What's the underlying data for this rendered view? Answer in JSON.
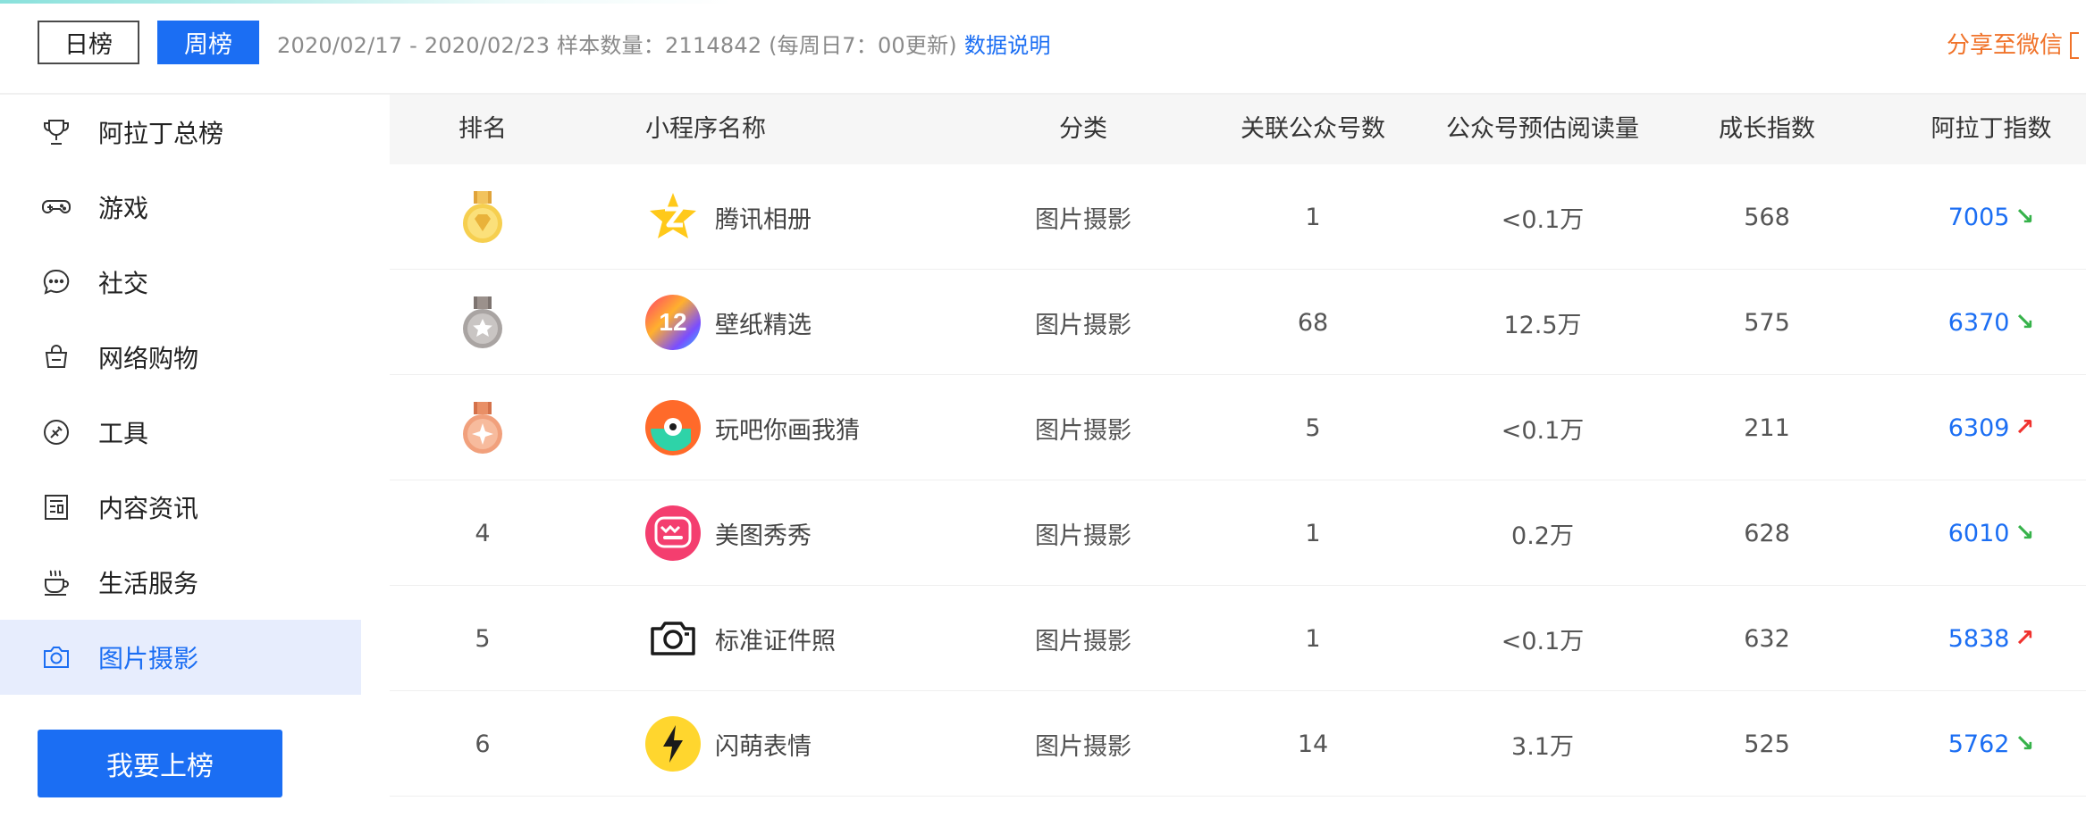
{
  "header": {
    "tab_daily": "日榜",
    "tab_weekly": "周榜",
    "date_range": "2020/02/17 - 2020/02/23  样本数量：2114842 (每周日7：00更新)",
    "data_explain": "数据说明",
    "share": "分享至微信"
  },
  "colors": {
    "accent": "#1b6ef3",
    "share": "#f0732a",
    "trend_down": "#36b24a",
    "trend_up": "#f0322e",
    "sidebar_active_bg": "#e7edfd"
  },
  "sidebar": {
    "items": [
      {
        "label": "阿拉丁总榜",
        "icon": "trophy-icon",
        "active": false
      },
      {
        "label": "游戏",
        "icon": "gamepad-icon",
        "active": false
      },
      {
        "label": "社交",
        "icon": "chat-bubble-icon",
        "active": false
      },
      {
        "label": "网络购物",
        "icon": "shopping-bag-icon",
        "active": false
      },
      {
        "label": "工具",
        "icon": "tool-icon",
        "active": false
      },
      {
        "label": "内容资讯",
        "icon": "news-icon",
        "active": false
      },
      {
        "label": "生活服务",
        "icon": "coffee-cup-icon",
        "active": false
      },
      {
        "label": "图片摄影",
        "icon": "camera-icon",
        "active": true
      }
    ],
    "cta_label": "我要上榜"
  },
  "table": {
    "columns": [
      "排名",
      "小程序名称",
      "分类",
      "关联公众号数",
      "公众号预估阅读量",
      "成长指数",
      "阿拉丁指数"
    ],
    "rows": [
      {
        "rank": "",
        "medal": "gold-medal-icon",
        "name": "腾讯相册",
        "app_icon": "tencent-album-icon",
        "category": "图片摄影",
        "linked_accounts": "1",
        "est_reads": "<0.1万",
        "growth": "568",
        "aladdin": "7005",
        "trend": "down"
      },
      {
        "rank": "",
        "medal": "silver-medal-icon",
        "name": "壁纸精选",
        "app_icon": "wallpaper-icon",
        "category": "图片摄影",
        "linked_accounts": "68",
        "est_reads": "12.5万",
        "growth": "575",
        "aladdin": "6370",
        "trend": "down"
      },
      {
        "rank": "",
        "medal": "bronze-medal-icon",
        "name": "玩吧你画我猜",
        "app_icon": "draw-guess-icon",
        "category": "图片摄影",
        "linked_accounts": "5",
        "est_reads": "<0.1万",
        "growth": "211",
        "aladdin": "6309",
        "trend": "up"
      },
      {
        "rank": "4",
        "medal": "",
        "name": "美图秀秀",
        "app_icon": "meitu-icon",
        "category": "图片摄影",
        "linked_accounts": "1",
        "est_reads": "0.2万",
        "growth": "628",
        "aladdin": "6010",
        "trend": "down"
      },
      {
        "rank": "5",
        "medal": "",
        "name": "标准证件照",
        "app_icon": "id-photo-camera-icon",
        "category": "图片摄影",
        "linked_accounts": "1",
        "est_reads": "<0.1万",
        "growth": "632",
        "aladdin": "5838",
        "trend": "up"
      },
      {
        "rank": "6",
        "medal": "",
        "name": "闪萌表情",
        "app_icon": "lightning-icon",
        "category": "图片摄影",
        "linked_accounts": "14",
        "est_reads": "3.1万",
        "growth": "525",
        "aladdin": "5762",
        "trend": "down"
      }
    ]
  }
}
